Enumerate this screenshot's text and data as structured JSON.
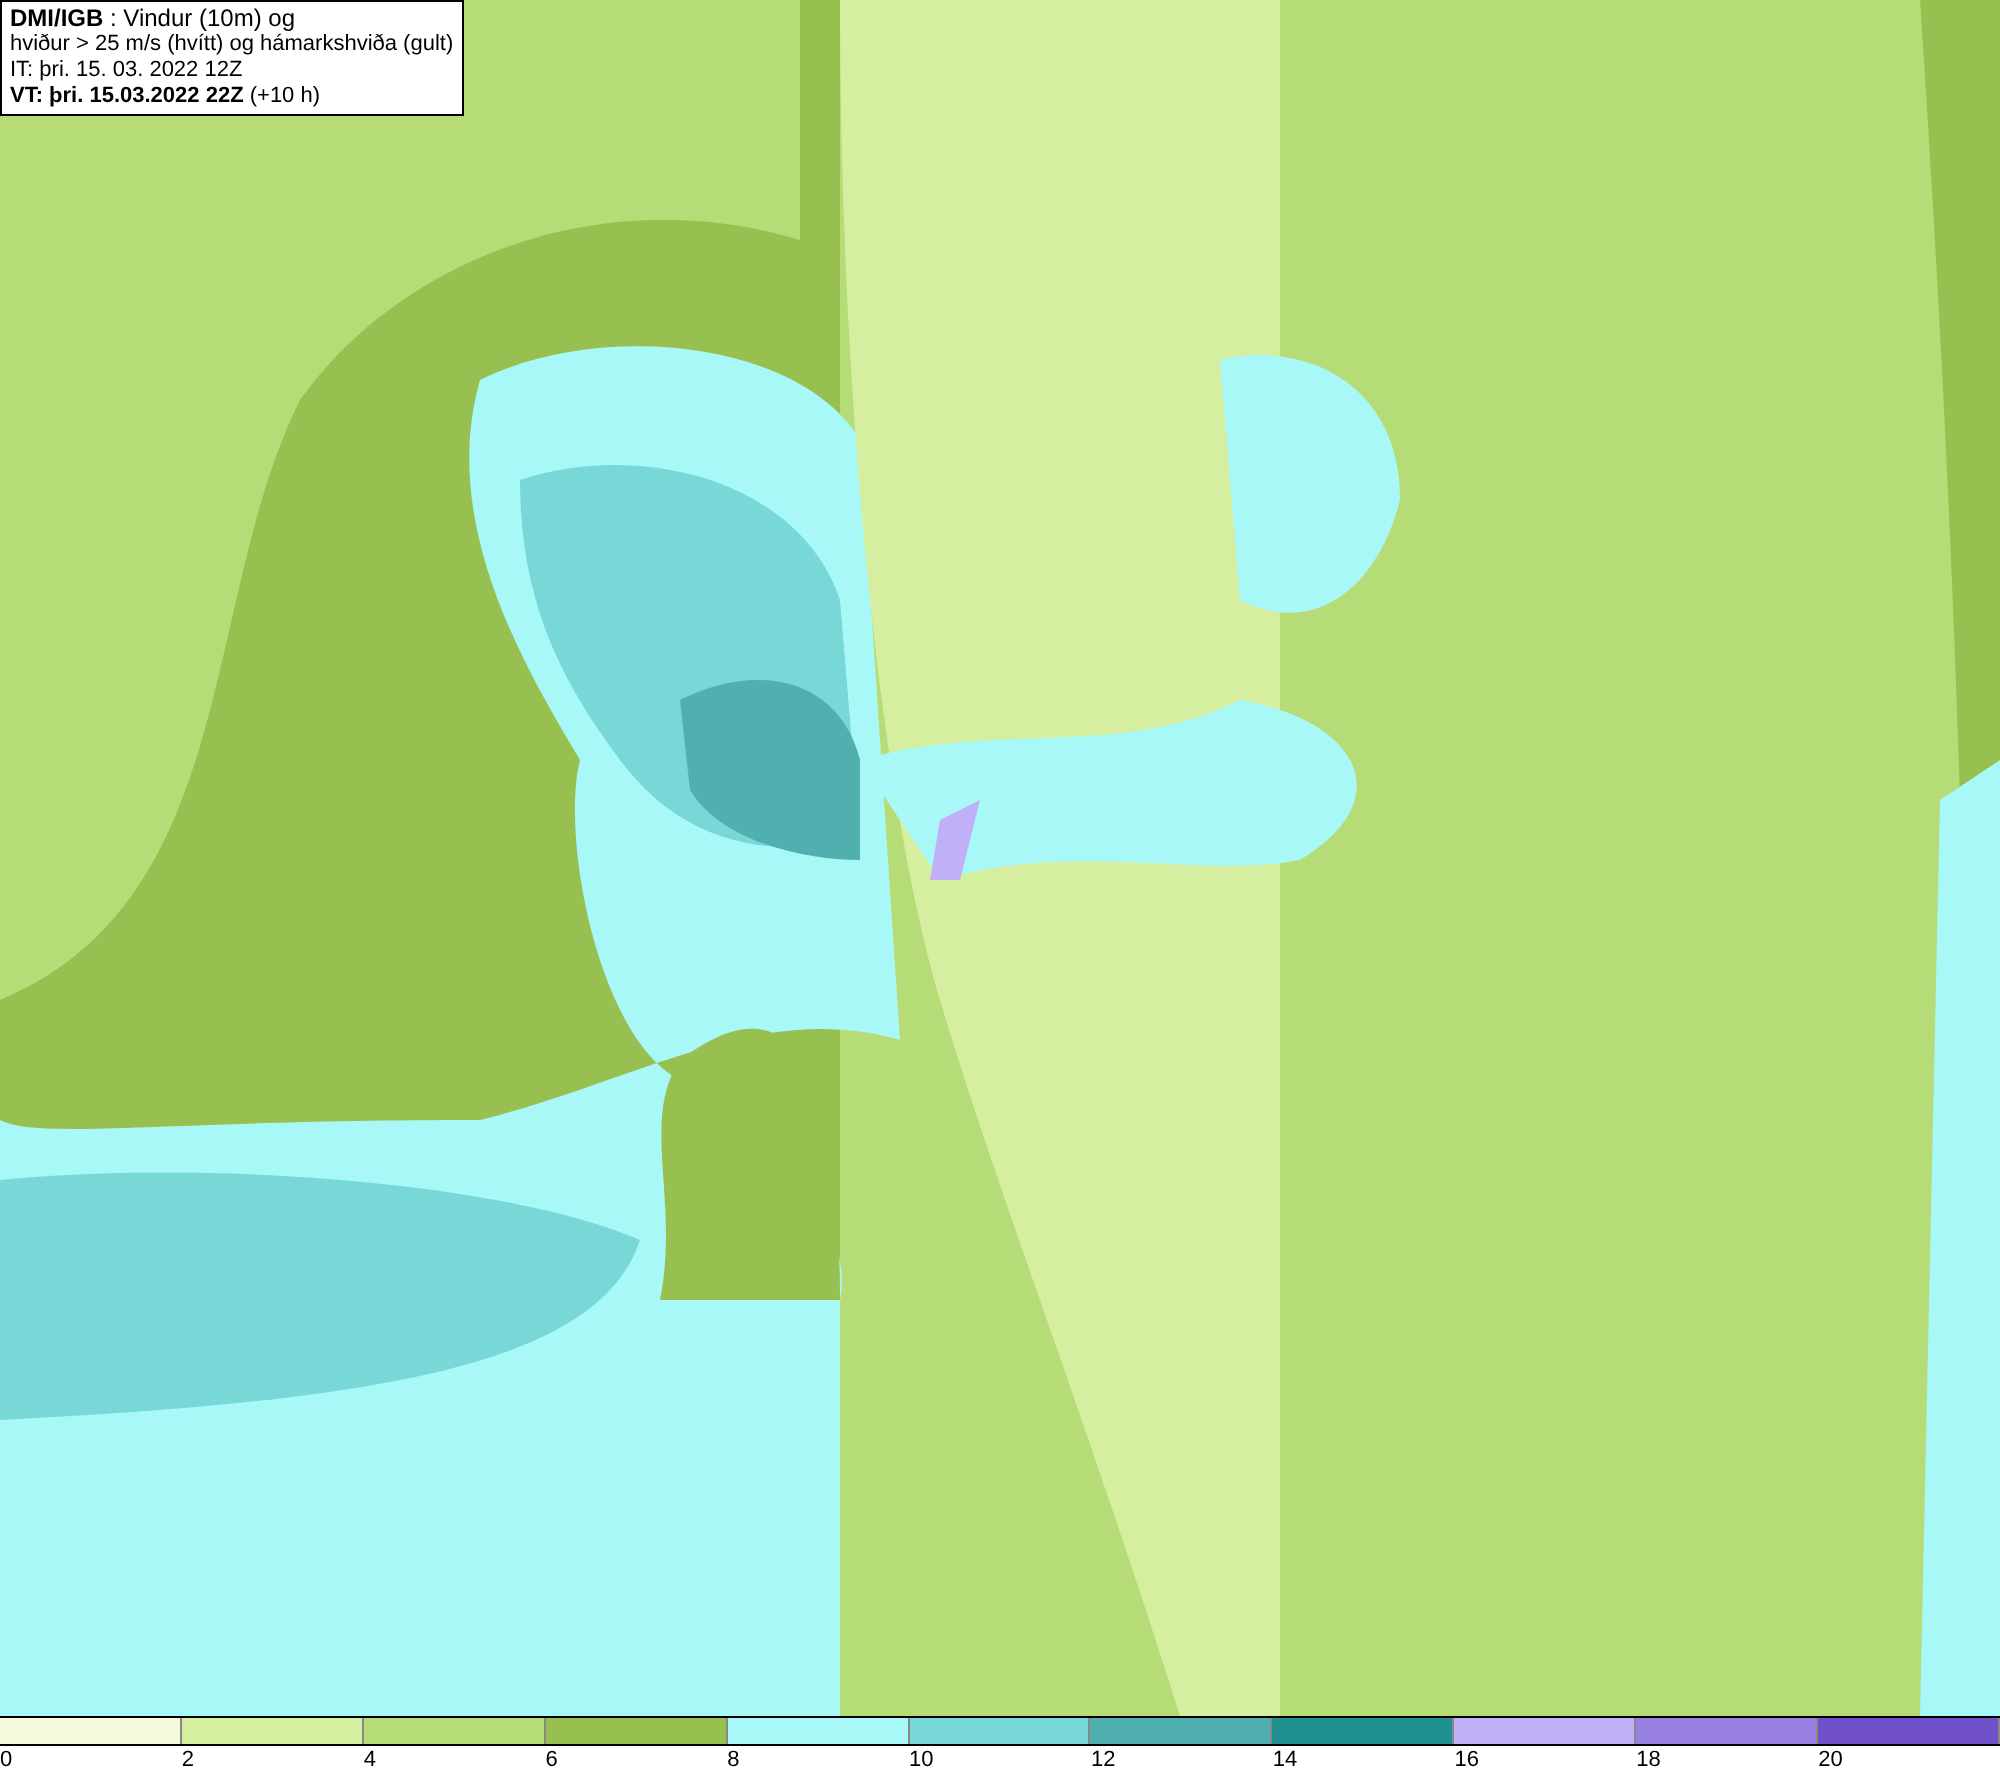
{
  "map": {
    "header": [
      "**DMI/IGB** : Vindur (10m) og",
      "hviður > 25 m/s (hvítt) og hámarkshviða (gult)",
      "IT: þri. 15. 03. 2022 12Z",
      "**VT: þri. 15.03.2022 22Z** (+10 h)"
    ]
  },
  "legend": [
    {
      "label": "0",
      "color": "#f6fadc"
    },
    {
      "label": "2",
      "color": "#d6eea0"
    },
    {
      "label": "4",
      "color": "#b6dc78"
    },
    {
      "label": "6",
      "color": "#98c050"
    },
    {
      "label": "8",
      "color": "#a8f8f8"
    },
    {
      "label": "10",
      "color": "#78d8d8"
    },
    {
      "label": "12",
      "color": "#50b0b0"
    },
    {
      "label": "14",
      "color": "#209090"
    },
    {
      "label": "16",
      "color": "#c0b0f8"
    },
    {
      "label": "18",
      "color": "#9880e0"
    },
    {
      "label": "20",
      "color": "#7050c8"
    }
  ]
}
